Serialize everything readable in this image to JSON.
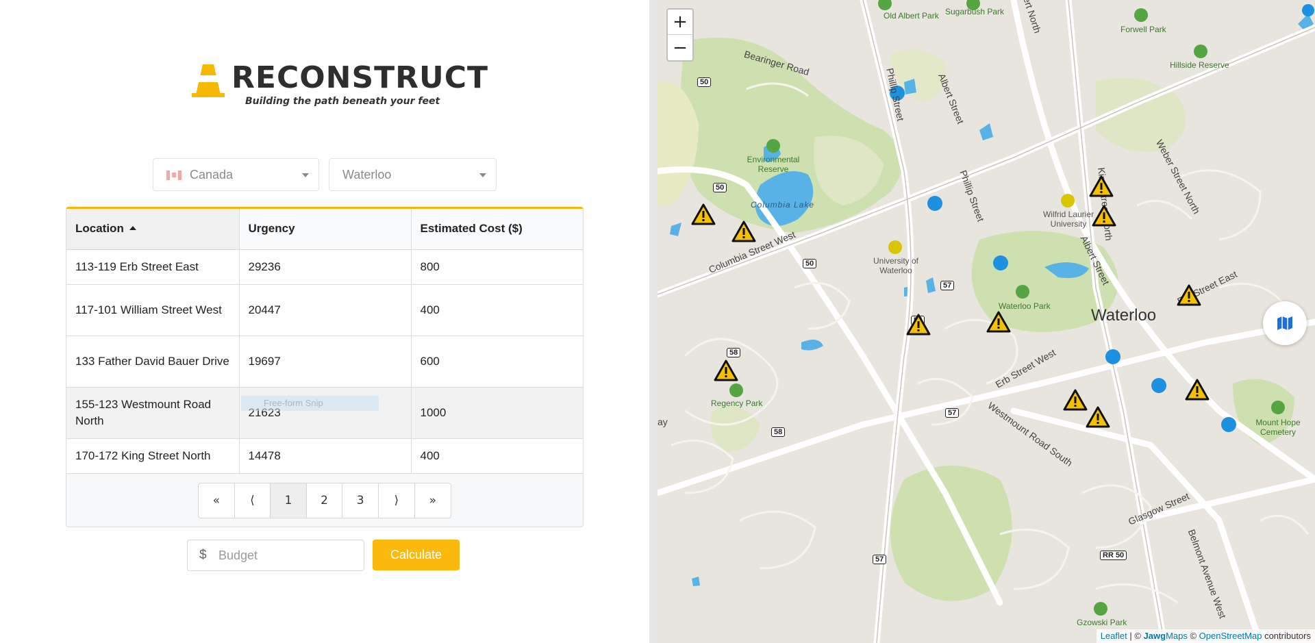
{
  "app": {
    "title": "RECONSTRUCT",
    "tagline": "Building the path beneath your feet"
  },
  "filters": {
    "country": "Canada",
    "city": "Waterloo"
  },
  "table": {
    "columns": [
      "Location",
      "Urgency",
      "Estimated Cost ($)"
    ],
    "rows": [
      [
        "113-119 Erb Street East",
        "29236",
        "800"
      ],
      [
        "117-101 William Street West",
        "20447",
        "400"
      ],
      [
        "133 Father David Bauer Drive",
        "19697",
        "600"
      ],
      [
        "155-123 Westmount Road North",
        "21623",
        "1000"
      ],
      [
        "170-172 King Street North",
        "14478",
        "400"
      ]
    ]
  },
  "overlay": {
    "snip_text": "Free-form Snip"
  },
  "pagination": {
    "first": "«",
    "prev": "⟨",
    "pages": [
      "1",
      "2",
      "3"
    ],
    "next": "⟩",
    "last": "»",
    "current": "1"
  },
  "budget": {
    "currency_symbol": "$",
    "placeholder": "Budget",
    "value": "",
    "calculate_label": "Calculate"
  },
  "map": {
    "zoom_in": "+",
    "zoom_out": "−",
    "city_label": "Waterloo",
    "attribution": {
      "leaflet": "Leaflet",
      "sep1": " | © ",
      "jawg_bold": "Jawg",
      "jawg_rest": "Maps",
      "sep2": " © ",
      "osm": "OpenStreetMap",
      "tail": " contributors"
    },
    "places": {
      "old_albert_park": "Old Albert Park",
      "sugarbush_park": "Sugarbush Park",
      "forwell_park": "Forwell Park",
      "hillside_reserve": "Hillside Reserve",
      "env_reserve": "Environmental Reserve",
      "columbia_lake": "Columbia Lake",
      "wilfrid_laurier": "Wilfrid Laurier University",
      "university_waterloo": "University of Waterloo",
      "waterloo_park": "Waterloo Park",
      "regency_park": "Regency Park",
      "mount_hope": "Mount Hope Cemetery",
      "gzowski_park": "Gzowski Park"
    },
    "streets": {
      "bearinger": "Bearinger Road",
      "phillip1": "Phillip Street",
      "albert1": "Albert Street",
      "weber": "Weber Street North",
      "phillip2": "Phillip Street",
      "columbia_w": "Columbia Street West",
      "albert2": "Albert Street",
      "erb": "Erb Street West",
      "westmount": "Westmount Road South",
      "glasgow": "Glasgow Street",
      "belmont": "Belmont Avenue West",
      "erb_east": "Erb Street East",
      "king": "King Street North",
      "bert": "ert North",
      "ray": "ay"
    },
    "shields": [
      "50",
      "50",
      "50",
      "57",
      "57",
      "57",
      "58",
      "58",
      "RR 50",
      "57"
    ]
  },
  "colors": {
    "accent": "#fbb90c",
    "warning_marker": "#f5c000",
    "water": "#58b2e6",
    "park": "#c8dfa6"
  }
}
